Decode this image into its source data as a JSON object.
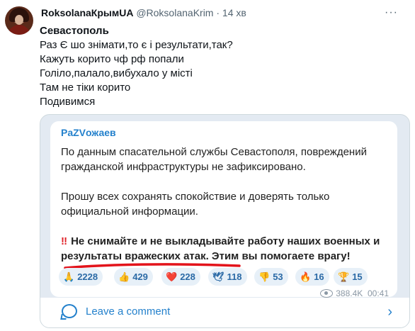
{
  "tweet_header": {
    "display_name": "RoksolanaКрымUA",
    "handle": "@RoksolanaKrim",
    "time": "· 14 хв",
    "more_icon": "more-dots-icon"
  },
  "tweet_lines": [
    "Севастополь",
    "Раз Є шо знімати,то є і   результати,так?",
    "Кажуть корито чф рф попали",
    "Голіло,палало,вибухало у місті",
    "Там не тіки корито",
    "Подивимся"
  ],
  "embed": {
    "channel_name": "PaZVожаев",
    "paragraph1": "По данным спасательной службы Севастополя, повреждений гражданской инфраструктуры не зафиксировано.",
    "paragraph2": "Прошу всех сохранять спокойствие и доверять только официальной информации.",
    "warning_mark": "‼",
    "warning": "Не снимайте и не выкладывайте работу наших военных и результаты вражеских атак. Этим вы помогаете врагу!",
    "reactions": [
      {
        "icon": "🙏",
        "count": "2228"
      },
      {
        "icon": "👍",
        "count": "429"
      },
      {
        "icon": "❤️",
        "count": "228"
      },
      {
        "icon": "🕊",
        "count": "118"
      },
      {
        "icon": "👎",
        "count": "53"
      },
      {
        "icon": "🔥",
        "count": "16"
      },
      {
        "icon": "🏆",
        "count": "15"
      }
    ],
    "views": "388.4K",
    "time": "00:41",
    "comment_label": "Leave a comment",
    "accent_color": "#2481cc",
    "underline_color": "#e3131b"
  }
}
